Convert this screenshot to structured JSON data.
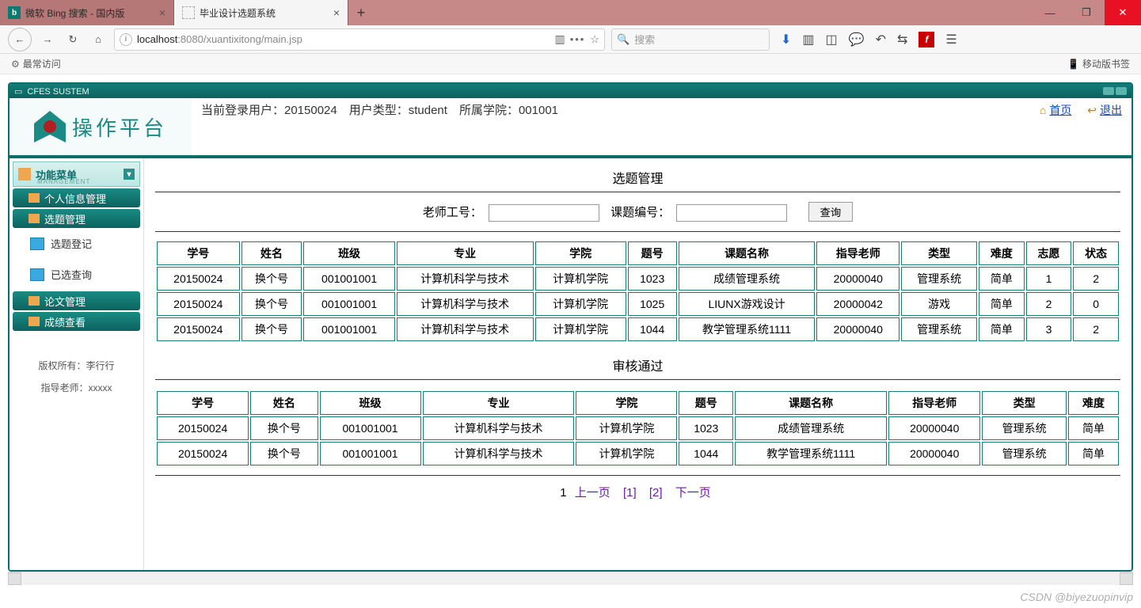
{
  "browser": {
    "tabs": [
      {
        "label": "微软 Bing 搜索 - 国内版",
        "active": false
      },
      {
        "label": "毕业设计选题系统",
        "active": true
      }
    ],
    "url_host": "localhost",
    "url_rest": ":8080/xuantixitong/main.jsp",
    "search_placeholder": "搜索",
    "most_visited": "最常访问",
    "mobile_bookmarks": "移动版书签"
  },
  "app": {
    "frame_title": "CFES SUSTEM",
    "platform_title": "操作平台",
    "login_info": "当前登录用户：20150024　用户类型：student　所属学院：001001",
    "home_label": "首页",
    "logout_label": "退出"
  },
  "sidebar": {
    "menu_title": "功能菜单",
    "menu_sub": "MANAGEMENT",
    "items": [
      {
        "label": "个人信息管理",
        "type": "bar"
      },
      {
        "label": "选题管理",
        "type": "bar"
      },
      {
        "label": "选题登记",
        "type": "sub"
      },
      {
        "label": "已选查询",
        "type": "sub"
      },
      {
        "label": "论文管理",
        "type": "bar"
      },
      {
        "label": "成绩查看",
        "type": "bar"
      }
    ],
    "copyright": "版权所有：李行行",
    "advisor": "指导老师：xxxxx"
  },
  "content": {
    "title1": "选题管理",
    "teacher_label": "老师工号：",
    "topic_label": "课题编号：",
    "query_btn": "查询",
    "table1": {
      "headers": [
        "学号",
        "姓名",
        "班级",
        "专业",
        "学院",
        "题号",
        "课题名称",
        "指导老师",
        "类型",
        "难度",
        "志愿",
        "状态"
      ],
      "rows": [
        [
          "20150024",
          "换个号",
          "001001001",
          "计算机科学与技术",
          "计算机学院",
          "1023",
          "成绩管理系统",
          "20000040",
          "管理系统",
          "简单",
          "1",
          "2"
        ],
        [
          "20150024",
          "换个号",
          "001001001",
          "计算机科学与技术",
          "计算机学院",
          "1025",
          "LIUNX游戏设计",
          "20000042",
          "游戏",
          "简单",
          "2",
          "0"
        ],
        [
          "20150024",
          "换个号",
          "001001001",
          "计算机科学与技术",
          "计算机学院",
          "1044",
          "教学管理系统1111",
          "20000040",
          "管理系统",
          "简单",
          "3",
          "2"
        ]
      ]
    },
    "title2": "审核通过",
    "table2": {
      "headers": [
        "学号",
        "姓名",
        "班级",
        "专业",
        "学院",
        "题号",
        "课题名称",
        "指导老师",
        "类型",
        "难度"
      ],
      "rows": [
        [
          "20150024",
          "换个号",
          "001001001",
          "计算机科学与技术",
          "计算机学院",
          "1023",
          "成绩管理系统",
          "20000040",
          "管理系统",
          "简单"
        ],
        [
          "20150024",
          "换个号",
          "001001001",
          "计算机科学与技术",
          "计算机学院",
          "1044",
          "教学管理系统1111",
          "20000040",
          "管理系统",
          "简单"
        ]
      ]
    },
    "pager": {
      "current": "1",
      "prev": "上一页",
      "p1": "[1]",
      "p2": "[2]",
      "next": "下一页"
    }
  },
  "watermark": "CSDN @biyezuopinvip"
}
